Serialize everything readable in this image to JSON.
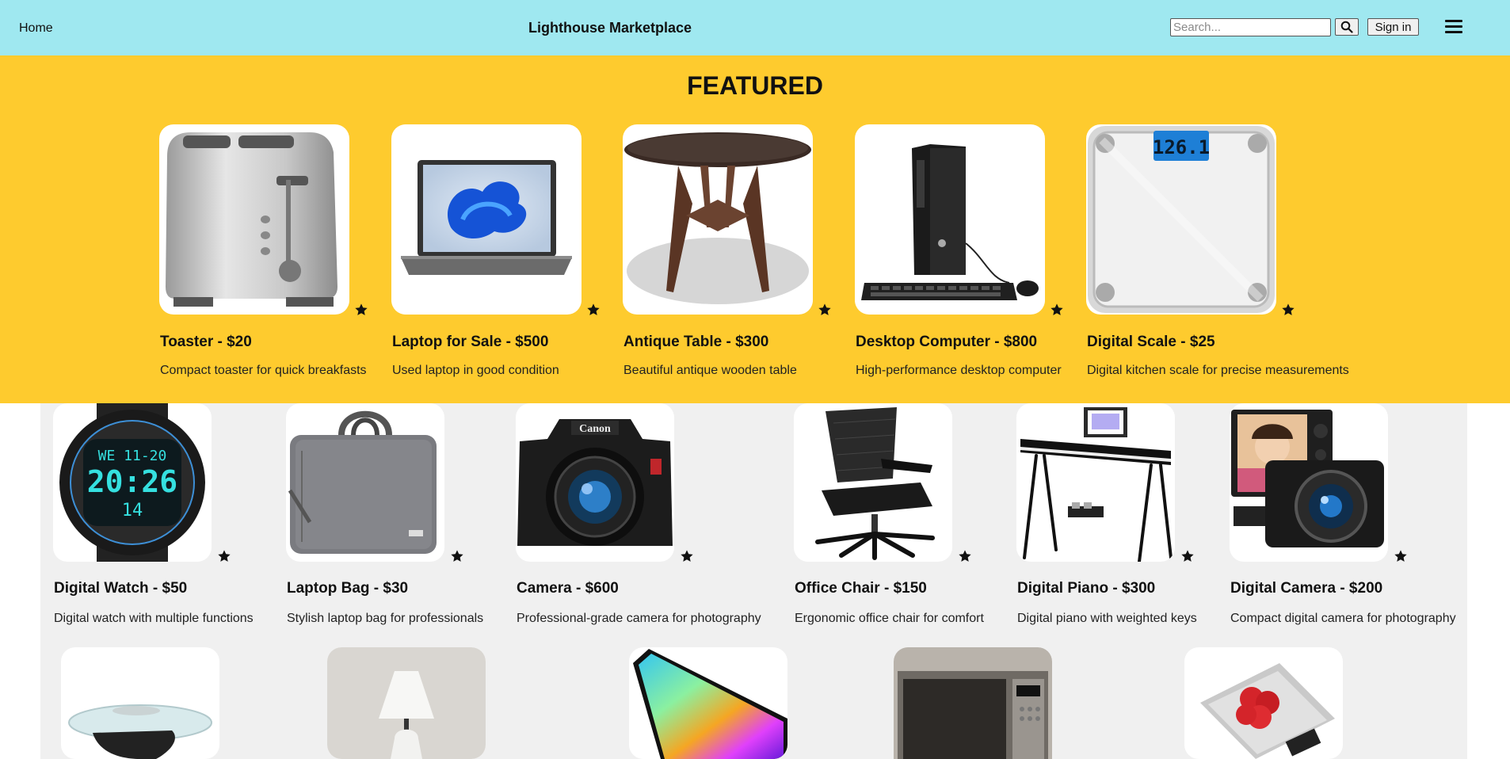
{
  "header": {
    "home_label": "Home",
    "site_title": "Lighthouse Marketplace",
    "search_placeholder": "Search...",
    "signin_label": "Sign in",
    "background": "#9fe8f0"
  },
  "featured": {
    "title": "FEATURED",
    "background": "#fecb2e",
    "items": [
      {
        "title": "Toaster - $20",
        "desc": "Compact toaster for quick breakfasts",
        "icon": "toaster-image"
      },
      {
        "title": "Laptop for Sale - $500",
        "desc": "Used laptop in good condition",
        "icon": "laptop-image"
      },
      {
        "title": "Antique Table - $300",
        "desc": "Beautiful antique wooden table",
        "icon": "table-image"
      },
      {
        "title": "Desktop Computer - $800",
        "desc": "High-performance desktop computer",
        "icon": "desktop-image"
      },
      {
        "title": "Digital Scale - $25",
        "desc": "Digital kitchen scale for precise measurements",
        "icon": "scale-image",
        "display": "126.1"
      }
    ]
  },
  "listings": {
    "items": [
      {
        "title": "Digital Watch - $50",
        "desc": "Digital watch with multiple functions",
        "icon": "watch-image",
        "display_top": "WE 11-20",
        "display_main": "20:26",
        "display_bottom": "14"
      },
      {
        "title": "Laptop Bag - $30",
        "desc": "Stylish laptop bag for professionals",
        "icon": "laptop-bag-image"
      },
      {
        "title": "Camera - $600",
        "desc": "Professional-grade camera for photography",
        "icon": "camera-image",
        "brand": "Canon"
      },
      {
        "title": "Office Chair - $150",
        "desc": "Ergonomic office chair for comfort",
        "icon": "chair-image"
      },
      {
        "title": "Digital Piano - $300",
        "desc": "Digital piano with weighted keys",
        "icon": "piano-image"
      },
      {
        "title": "Digital Camera - $200",
        "desc": "Compact digital camera for photography",
        "icon": "compact-camera-image"
      }
    ],
    "third_row": [
      {
        "icon": "glass-table-image"
      },
      {
        "icon": "lamp-image"
      },
      {
        "icon": "monitor-image"
      },
      {
        "icon": "microwave-image"
      },
      {
        "icon": "kitchen-scale-image"
      }
    ]
  }
}
